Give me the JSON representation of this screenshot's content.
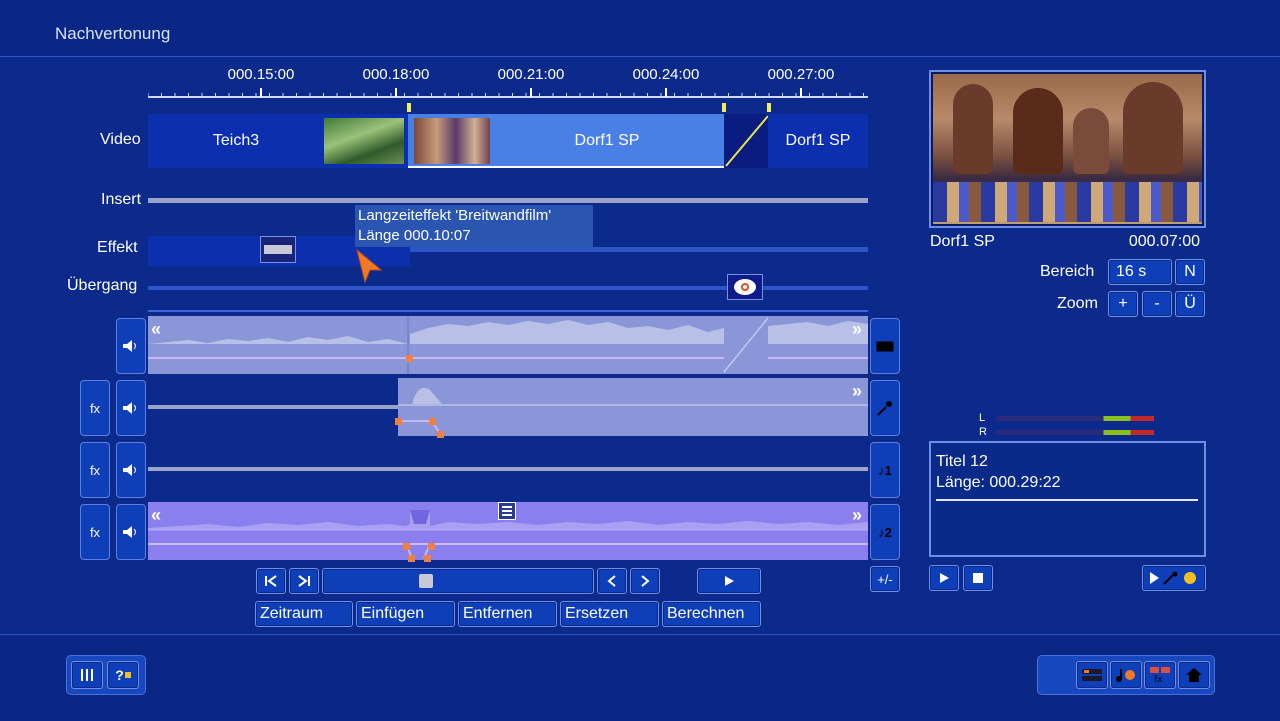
{
  "header": {
    "title": "Nachvertonung"
  },
  "timeline": {
    "ticks": [
      "000.15:00",
      "000.18:00",
      "000.21:00",
      "000.24:00",
      "000.27:00"
    ]
  },
  "tracks": {
    "video_label": "Video",
    "insert_label": "Insert",
    "effect_label": "Effekt",
    "transition_label": "Übergang"
  },
  "clips": {
    "clip1": "Teich3",
    "clip2": "Dorf1 SP",
    "clip3": "Dorf1 SP"
  },
  "tooltip": {
    "line1": "Langzeiteffekt 'Breitwandfilm'",
    "line2": "Länge 000.10:07"
  },
  "audio": {
    "fx_label": "fx",
    "scroll_left": "«",
    "scroll_right": "»",
    "track3_label": "♪1",
    "track4_label": "♪2",
    "plusminus": "+/-"
  },
  "transport": {
    "btn_zeitraum": "Zeitraum",
    "btn_einfuegen": "Einfügen",
    "btn_entfernen": "Entfernen",
    "btn_ersetzen": "Ersetzen",
    "btn_berechnen": "Berechnen"
  },
  "preview": {
    "clip_name": "Dorf1 SP",
    "timecode": "000.07:00",
    "bereich_label": "Bereich",
    "bereich_value": "16 s",
    "bereich_n": "N",
    "zoom_label": "Zoom",
    "zoom_plus": "+",
    "zoom_minus": "-",
    "zoom_u": "Ü"
  },
  "meter": {
    "l": "L",
    "r": "R"
  },
  "info": {
    "title": "Titel 12",
    "length": "Länge: 000.29:22"
  },
  "footer": {
    "help_label": "?"
  },
  "colors": {
    "background": "#0b2a8c",
    "clip_selected": "#4a7fe6",
    "clip_dark": "#0c2fb0",
    "audio_lane": "#8a96d8",
    "audio_active": "#8b7ff0",
    "node": "#f08040"
  }
}
